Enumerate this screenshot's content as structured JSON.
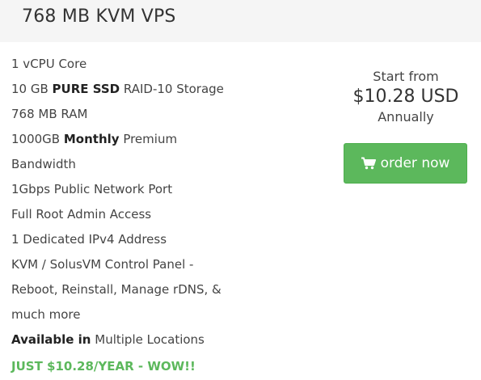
{
  "header": {
    "title": "768 MB KVM VPS"
  },
  "features": [
    {
      "prefix": "1 vCPU Core",
      "bold": "",
      "suffix": ""
    },
    {
      "prefix": "10 GB ",
      "bold": "PURE SSD",
      "suffix": " RAID-10 Storage"
    },
    {
      "prefix": "768 MB RAM",
      "bold": "",
      "suffix": ""
    },
    {
      "prefix": "1000GB ",
      "bold": "Monthly",
      "suffix": " Premium"
    },
    {
      "prefix": "Bandwidth",
      "bold": "",
      "suffix": ""
    },
    {
      "prefix": "1Gbps Public Network Port",
      "bold": "",
      "suffix": ""
    },
    {
      "prefix": "Full Root Admin Access",
      "bold": "",
      "suffix": ""
    },
    {
      "prefix": "1 Dedicated IPv4 Address",
      "bold": "",
      "suffix": ""
    },
    {
      "prefix": "KVM / SolusVM Control Panel -",
      "bold": "",
      "suffix": ""
    },
    {
      "prefix": "Reboot, Reinstall, Manage rDNS, &",
      "bold": "",
      "suffix": ""
    },
    {
      "prefix": "much more",
      "bold": "",
      "suffix": ""
    },
    {
      "prefix": "",
      "bold": "Available in",
      "suffix": " Multiple Locations"
    }
  ],
  "promo": "JUST $10.28/YEAR - WOW!!",
  "pricing": {
    "start_from": "Start from",
    "price": "$10.28 USD",
    "period": "Annually"
  },
  "order_button": {
    "label": "order now",
    "icon": "shopping-cart-icon"
  },
  "colors": {
    "header_bg": "#f5f5f5",
    "accent_green": "#5cb85c",
    "text": "#444444"
  }
}
